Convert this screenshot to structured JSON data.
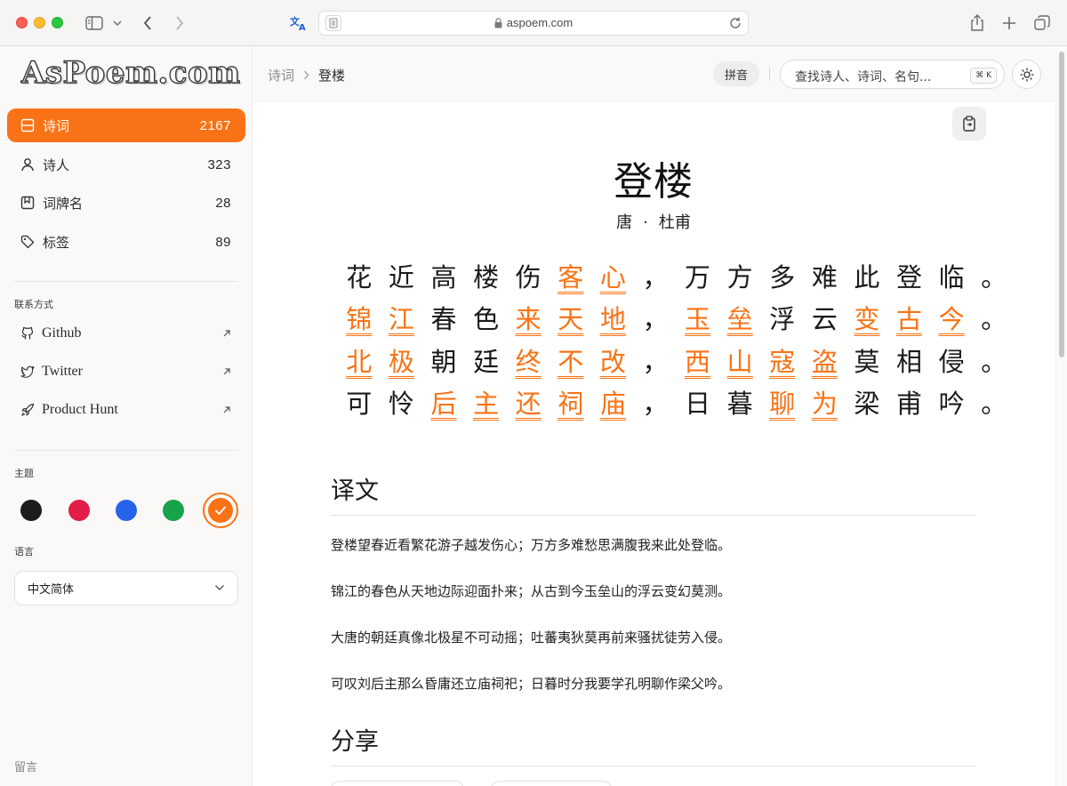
{
  "browser": {
    "url": "aspoem.com"
  },
  "sidebar": {
    "logo": "AsPoem.com",
    "nav": [
      {
        "label": "诗词",
        "count": "2167"
      },
      {
        "label": "诗人",
        "count": "323"
      },
      {
        "label": "词牌名",
        "count": "28"
      },
      {
        "label": "标签",
        "count": "89"
      }
    ],
    "contact_title": "联系方式",
    "links": [
      {
        "label": "Github"
      },
      {
        "label": "Twitter"
      },
      {
        "label": "Product Hunt"
      }
    ],
    "theme_title": "主题",
    "theme_colors": [
      "#1c1c1e",
      "#e11d48",
      "#2563eb",
      "#16a34a",
      "#f97316"
    ],
    "selected_theme": "#f97316",
    "language_title": "语言",
    "language_value": "中文简体",
    "footer": "留言"
  },
  "topbar": {
    "breadcrumb_root": "诗词",
    "breadcrumb_current": "登楼",
    "pinyin_label": "拼音",
    "search_placeholder": "查找诗人、诗词、名句...",
    "search_shortcut": "⌘ K"
  },
  "poem": {
    "title": "登楼",
    "dynasty": "唐",
    "author": "杜甫",
    "lines": [
      [
        {
          "t": "花近高楼伤"
        },
        {
          "t": "客心",
          "note": true
        },
        {
          "t": "，万方多难此登临。"
        }
      ],
      [
        {
          "t": "锦江",
          "note": true
        },
        {
          "t": "春色"
        },
        {
          "t": "来天地",
          "note": true
        },
        {
          "t": "，"
        },
        {
          "t": "玉垒",
          "note": true
        },
        {
          "t": "浮云"
        },
        {
          "t": "变古今",
          "note": true
        },
        {
          "t": "。"
        }
      ],
      [
        {
          "t": "北极",
          "note": true
        },
        {
          "t": "朝廷"
        },
        {
          "t": "终不改",
          "note": true
        },
        {
          "t": "，"
        },
        {
          "t": "西山",
          "note": true
        },
        {
          "t": "寇盗",
          "note": true
        },
        {
          "t": "莫相侵。"
        }
      ],
      [
        {
          "t": "可怜"
        },
        {
          "t": "后主",
          "note": true
        },
        {
          "t": "还祠庙",
          "note": true
        },
        {
          "t": "，日暮"
        },
        {
          "t": "聊为",
          "note": true
        },
        {
          "t": "梁甫吟。"
        }
      ]
    ]
  },
  "translation": {
    "heading": "译文",
    "lines": [
      "登楼望春近看繁花游子越发伤心；万方多难愁思满腹我来此处登临。",
      "锦江的春色从天地边际迎面扑来；从古到今玉垒山的浮云变幻莫测。",
      "大唐的朝廷真像北极星不可动摇；吐蕃夷狄莫再前来骚扰徒劳入侵。",
      "可叹刘后主那么昏庸还立庙祠祀；日暮时分我要学孔明聊作梁父吟。"
    ]
  },
  "share": {
    "heading": "分享"
  }
}
